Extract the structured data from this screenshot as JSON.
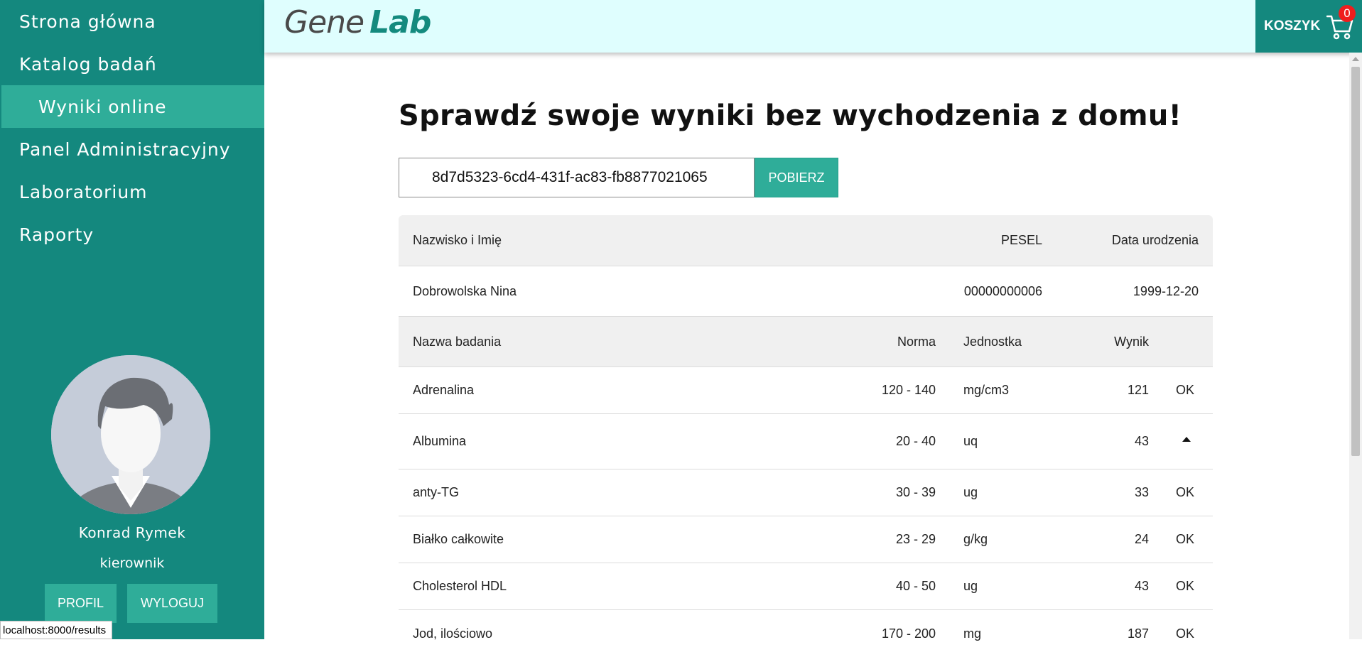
{
  "sidebar": {
    "items": [
      {
        "label": "Strona główna"
      },
      {
        "label": "Katalog badań"
      },
      {
        "label": "Wyniki online"
      },
      {
        "label": "Panel Administracyjny"
      },
      {
        "label": "Laboratorium"
      },
      {
        "label": "Raporty"
      }
    ],
    "active_index": 2,
    "user": {
      "name": "Konrad Rymek",
      "role": "kierownik"
    },
    "profile_button": "PROFIL",
    "logout_button": "WYLOGUJ"
  },
  "header": {
    "logo_part1": "Gene",
    "logo_part2": "Lab",
    "cart_label": "KOSZYK",
    "cart_count": "0"
  },
  "main": {
    "title": "Sprawdź swoje wyniki bez wychodzenia z domu!",
    "code_value": "8d7d5323-6cd4-431f-ac83-fb8877021065",
    "fetch_button": "POBIERZ",
    "patient_headers": {
      "name": "Nazwisko i Imię",
      "pesel": "PESEL",
      "birth": "Data urodzenia"
    },
    "patient": {
      "name": "Dobrowolska Nina",
      "pesel": "00000000006",
      "birth": "1999-12-20"
    },
    "test_headers": {
      "name": "Nazwa badania",
      "norm": "Norma",
      "unit": "Jednostka",
      "result": "Wynik"
    },
    "tests": [
      {
        "name": "Adrenalina",
        "norm": "120 - 140",
        "unit": "mg/cm3",
        "result": "121",
        "status": "OK"
      },
      {
        "name": "Albumina",
        "norm": "20 - 40",
        "unit": "uq",
        "result": "43",
        "status": "",
        "status_icon": "arrow-up-icon"
      },
      {
        "name": "anty-TG",
        "norm": "30 - 39",
        "unit": "ug",
        "result": "33",
        "status": "OK"
      },
      {
        "name": "Białko całkowite",
        "norm": "23 - 29",
        "unit": "g/kg",
        "result": "24",
        "status": "OK"
      },
      {
        "name": "Cholesterol HDL",
        "norm": "40 - 50",
        "unit": "ug",
        "result": "43",
        "status": "OK"
      },
      {
        "name": "Jod, ilościowo",
        "norm": "170 - 200",
        "unit": "mg",
        "result": "187",
        "status": "OK"
      }
    ]
  },
  "status_bar": {
    "url": "localhost:8000/results"
  },
  "colors": {
    "sidebar": "#14887e",
    "accent": "#2fad99",
    "header_bg": "#dffefe",
    "badge": "#ef1d1d"
  }
}
